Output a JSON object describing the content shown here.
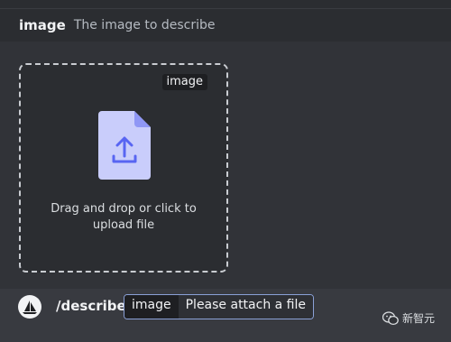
{
  "option": {
    "name": "image",
    "description": "The image to describe"
  },
  "dropzone": {
    "tag": "image",
    "line1": "Drag and drop or click to",
    "line2": "upload file",
    "icon": "file-upload-icon"
  },
  "command": {
    "name": "/describe",
    "param_label": "image",
    "param_placeholder": "Please attach a file"
  },
  "watermark": {
    "text": "新智元",
    "icon": "wechat-icon"
  },
  "colors": {
    "background": "#313338",
    "panel": "#2b2d31",
    "file_icon": "#c9cdfb",
    "accent": "#5865f2"
  }
}
